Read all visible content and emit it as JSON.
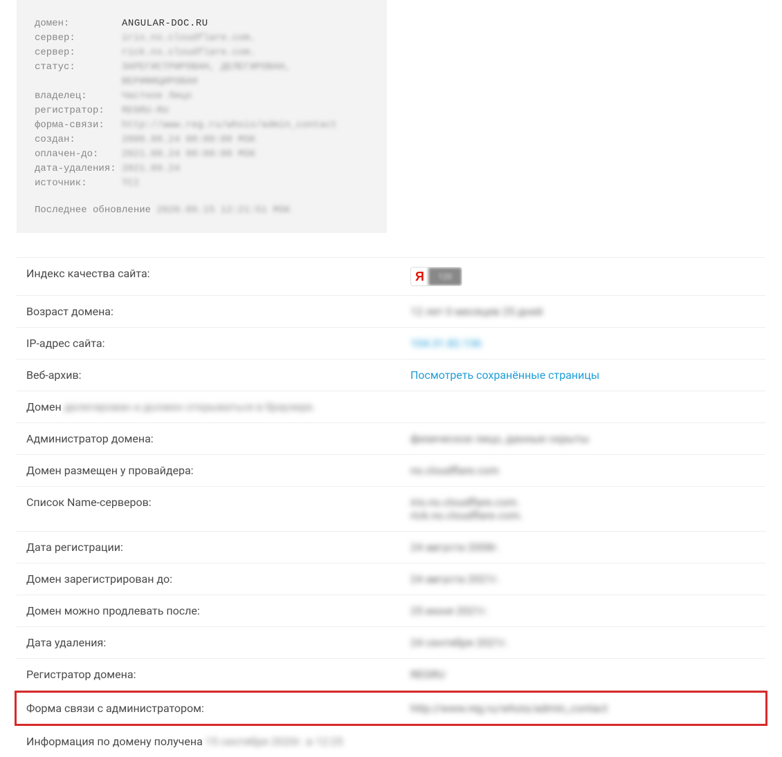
{
  "whois": {
    "rows": [
      {
        "label": "домен:         ",
        "value": "ANGULAR-DOC.RU",
        "is_domain": true
      },
      {
        "label": "сервер:        ",
        "value": "iris.ns.cloudflare.com.",
        "blurred": true
      },
      {
        "label": "сервер:        ",
        "value": "rick.ns.cloudflare.com.",
        "blurred": true
      },
      {
        "label": "статус:        ",
        "value": "ЗАРЕГИСТРИРОВАН, ДЕЛЕГИРОВАН, ВЕРИФИЦИРОВАН",
        "blurred": true
      },
      {
        "label": "владелец:      ",
        "value": "Частное Лицо",
        "blurred": true
      },
      {
        "label": "регистратор:   ",
        "value": "REGRU-RU",
        "blurred": true
      },
      {
        "label": "форма-связи:   ",
        "value": "http://www.reg.ru/whois/admin_contact",
        "blurred": true
      },
      {
        "label": "создан:        ",
        "value": "2008.08.24 00:00:00 MSK",
        "blurred": true
      },
      {
        "label": "оплачен-до:    ",
        "value": "2021.08.24 00:00:00 MSK",
        "blurred": true
      },
      {
        "label": "дата-удаления: ",
        "value": "2021.09.24",
        "blurred": true
      },
      {
        "label": "источник:      ",
        "value": "TCI",
        "blurred": true
      }
    ],
    "update_label": "Последнее обновление ",
    "update_value": "2020.09.15 12:21:51 MSK"
  },
  "details": {
    "quality_label": "Индекс качества сайта:",
    "quality_ya": "Я",
    "quality_score": "120",
    "age_label": "Возраст домена:",
    "age_value": "12 лет 0 месяцев 25 дней",
    "ip_label": "IP-адрес сайта:",
    "ip_value": "104.31.82.136",
    "archive_label": "Веб-архив:",
    "archive_link": "Посмотреть сохранённые страницы",
    "delegation_prefix": "Домен ",
    "delegation_value": "делегирован и должен открываться в браузере.",
    "admin_label": "Администратор домена:",
    "admin_value": "физическое лицо, данные скрыты",
    "provider_label": "Домен размещен у провайдера:",
    "provider_value": "ns.cloudflare.com",
    "ns_label": "Список Name-серверов:",
    "ns_value1": "iris.ns.cloudflare.com.",
    "ns_value2": "rick.ns.cloudflare.com.",
    "reg_date_label": "Дата регистрации:",
    "reg_date_value": "24 августа 2008г.",
    "reg_until_label": "Домен зарегистрирован до:",
    "reg_until_value": "24 августа 2021г.",
    "renew_label": "Домен можно продлевать после:",
    "renew_value": "25 июня 2021г.",
    "delete_label": "Дата удаления:",
    "delete_value": "24 сентября 2021г.",
    "registrar_label": "Регистратор домена:",
    "registrar_value": "REGRU",
    "contact_label": "Форма связи с администратором:",
    "contact_value": "http://www.reg.ru/whois/admin_contact",
    "info_prefix": "Информация по домену получена ",
    "info_value": "15 сентября 2020г. в 12:25"
  }
}
